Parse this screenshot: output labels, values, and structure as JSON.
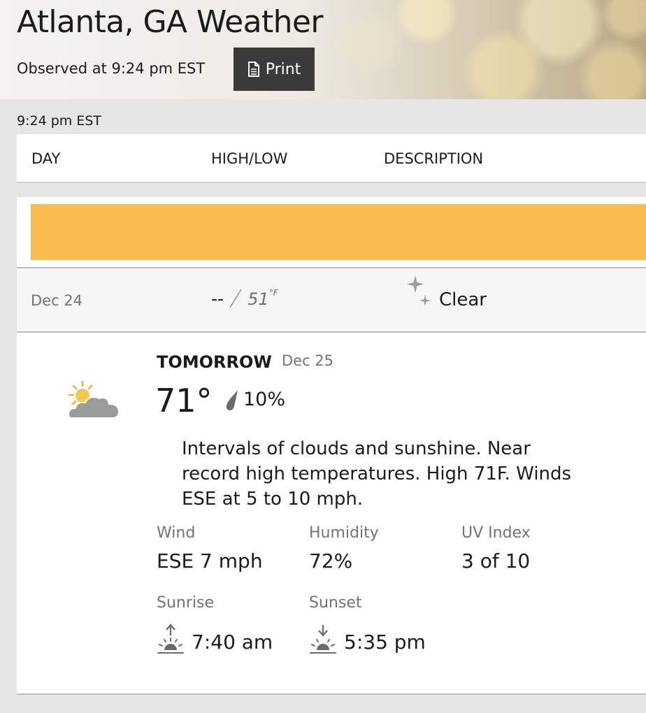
{
  "header": {
    "title": "Atlanta, GA Weather",
    "observed": "Observed at 9:24 pm EST",
    "print_label": "Print"
  },
  "timestamp": "9:24 pm EST",
  "table": {
    "columns": [
      "DAY",
      "HIGH/LOW",
      "DESCRIPTION"
    ]
  },
  "colors": {
    "banner": "#fcbb4f",
    "icon_gray": "#9b9b9b",
    "sun_yellow": "#f2c94c"
  },
  "today": {
    "date": "Dec 24",
    "high": "--",
    "low": "51",
    "unit": "°F",
    "description": "Clear",
    "icon": "moon-stars-icon"
  },
  "tomorrow": {
    "label": "TOMORROW",
    "date": "Dec 25",
    "temp": "71°",
    "precip": "10%",
    "icon": "partly-cloudy-icon",
    "description": "Intervals of clouds and sunshine. Near record high temperatures. High 71F. Winds ESE at 5 to 10 mph.",
    "details": {
      "wind_label": "Wind",
      "wind_value": "ESE 7 mph",
      "humidity_label": "Humidity",
      "humidity_value": "72%",
      "uv_label": "UV Index",
      "uv_value": "3 of 10",
      "sunrise_label": "Sunrise",
      "sunrise_value": "7:40 am",
      "sunset_label": "Sunset",
      "sunset_value": "5:35 pm"
    }
  }
}
